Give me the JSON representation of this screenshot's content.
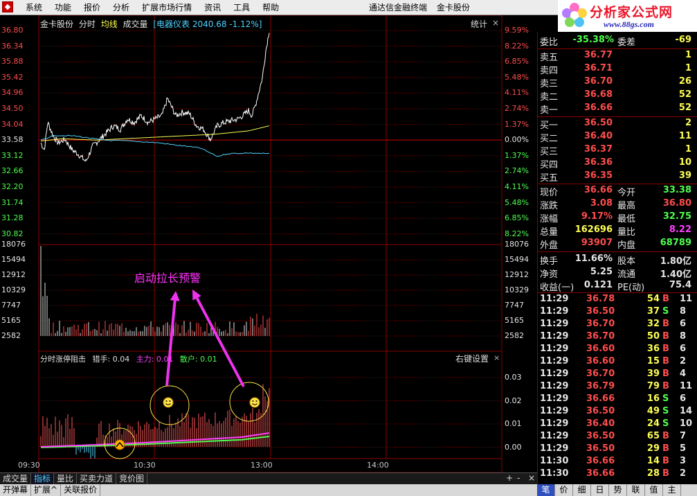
{
  "menubar": {
    "items": [
      "系统",
      "功能",
      "报价",
      "分析",
      "扩展市场行情",
      "资讯",
      "工具",
      "帮助"
    ],
    "app_title": "通达信金融终端",
    "stock_title": "金卡股份"
  },
  "brand": {
    "title": "分析家公式网",
    "url": "www.88gs.com"
  },
  "chart_header": {
    "name": "金卡股份",
    "tab_timeshare": "分时",
    "avg": "均线",
    "vol": "成交量",
    "index": "[电器仪表 2040.68 -1.12%]",
    "stats": "统计",
    "close": "×"
  },
  "price_axis": {
    "left": [
      "36.80",
      "36.34",
      "35.88",
      "35.42",
      "34.96",
      "34.50",
      "34.04",
      "33.58",
      "33.12",
      "32.66",
      "32.20",
      "31.74",
      "31.28",
      "30.82"
    ],
    "right": [
      "9.59%",
      "8.22%",
      "6.85%",
      "5.48%",
      "4.11%",
      "2.74%",
      "1.37%",
      "0.00%",
      "1.37%",
      "2.74%",
      "4.11%",
      "5.48%",
      "6.85%",
      "8.22%"
    ]
  },
  "volume_axis": [
    "18076",
    "15494",
    "12912",
    "10329",
    "7747",
    "5165",
    "2582"
  ],
  "indicator": {
    "title": "分时涨停阻击",
    "hunter": "猎手: 0.04",
    "main": "主力: 0.01",
    "retail": "散户: 0.01",
    "right_key": "右键设置",
    "close": "×",
    "axis": [
      "0.03",
      "0.02",
      "0.01",
      "0.00"
    ]
  },
  "annotation": "启动拉长预警",
  "time_axis": [
    "09:30",
    "10:30",
    "13:00",
    "14:00"
  ],
  "tabs_row1": [
    "成交量",
    "指标",
    "量比",
    "买卖力道",
    "竞价图"
  ],
  "tabs_row2": [
    "开弹幕",
    "扩展^",
    "关联报价"
  ],
  "controls": {
    "plus": "+",
    "minus": "-",
    "close": "×"
  },
  "order_book": {
    "ratio": {
      "label": "委比",
      "value": "-35.38%",
      "label2": "委差",
      "value2": "-69"
    },
    "asks": [
      {
        "label": "卖五",
        "price": "36.77",
        "vol": "1"
      },
      {
        "label": "卖四",
        "price": "36.71",
        "vol": "1"
      },
      {
        "label": "卖三",
        "price": "36.70",
        "vol": "26"
      },
      {
        "label": "卖二",
        "price": "36.68",
        "vol": "52"
      },
      {
        "label": "卖一",
        "price": "36.66",
        "vol": "52"
      }
    ],
    "bids": [
      {
        "label": "买一",
        "price": "36.50",
        "vol": "2"
      },
      {
        "label": "买二",
        "price": "36.40",
        "vol": "11"
      },
      {
        "label": "买三",
        "price": "36.37",
        "vol": "1"
      },
      {
        "label": "买四",
        "price": "36.36",
        "vol": "10"
      },
      {
        "label": "买五",
        "price": "36.35",
        "vol": "39"
      }
    ]
  },
  "stats": [
    {
      "l1": "现价",
      "v1": "36.66",
      "c1": "red",
      "l2": "今开",
      "v2": "33.38",
      "c2": "green"
    },
    {
      "l1": "涨跌",
      "v1": "3.08",
      "c1": "red",
      "l2": "最高",
      "v2": "36.80",
      "c2": "red"
    },
    {
      "l1": "涨幅",
      "v1": "9.17%",
      "c1": "red",
      "l2": "最低",
      "v2": "32.75",
      "c2": "green"
    },
    {
      "l1": "总量",
      "v1": "162696",
      "c1": "yellow",
      "l2": "量比",
      "v2": "8.22",
      "c2": "magenta"
    },
    {
      "l1": "外盘",
      "v1": "93907",
      "c1": "red",
      "l2": "内盘",
      "v2": "68789",
      "c2": "green"
    },
    {
      "l1": "换手",
      "v1": "11.66%",
      "c1": "white",
      "l2": "股本",
      "v2": "1.80亿",
      "c2": "white"
    },
    {
      "l1": "净资",
      "v1": "5.25",
      "c1": "white",
      "l2": "流通",
      "v2": "1.40亿",
      "c2": "white"
    },
    {
      "l1": "收益(一)",
      "v1": "0.121",
      "c1": "white",
      "l2": "PE(动)",
      "v2": "75.4",
      "c2": "white"
    }
  ],
  "ticks": [
    {
      "t": "11:29",
      "p": "36.78",
      "v": "54",
      "d": "B",
      "n": "11"
    },
    {
      "t": "11:29",
      "p": "36.50",
      "v": "37",
      "d": "S",
      "n": "8"
    },
    {
      "t": "11:29",
      "p": "36.70",
      "v": "32",
      "d": "B",
      "n": "6"
    },
    {
      "t": "11:29",
      "p": "36.70",
      "v": "50",
      "d": "B",
      "n": "8"
    },
    {
      "t": "11:29",
      "p": "36.60",
      "v": "36",
      "d": "B",
      "n": "6"
    },
    {
      "t": "11:29",
      "p": "36.60",
      "v": "15",
      "d": "B",
      "n": "2"
    },
    {
      "t": "11:29",
      "p": "36.70",
      "v": "39",
      "d": "B",
      "n": "4"
    },
    {
      "t": "11:29",
      "p": "36.79",
      "v": "79",
      "d": "B",
      "n": "11"
    },
    {
      "t": "11:29",
      "p": "36.66",
      "v": "16",
      "d": "S",
      "n": "6"
    },
    {
      "t": "11:29",
      "p": "36.50",
      "v": "49",
      "d": "S",
      "n": "14"
    },
    {
      "t": "11:29",
      "p": "36.40",
      "v": "24",
      "d": "S",
      "n": "10"
    },
    {
      "t": "11:29",
      "p": "36.50",
      "v": "65",
      "d": "B",
      "n": "7"
    },
    {
      "t": "11:29",
      "p": "36.50",
      "v": "29",
      "d": "B",
      "n": "5"
    },
    {
      "t": "11:30",
      "p": "36.66",
      "v": "14",
      "d": "B",
      "n": "3"
    },
    {
      "t": "11:30",
      "p": "36.66",
      "v": "28",
      "d": "B",
      "n": "2"
    }
  ],
  "panel_tabs": [
    "笔",
    "价",
    "细",
    "日",
    "势",
    "联",
    "值",
    "主"
  ],
  "colors": {
    "up": "#ff4d4d",
    "down": "#4fff4f",
    "grid": "#8a0000",
    "avg": "#ffff54",
    "index": "#4fd3ff"
  }
}
